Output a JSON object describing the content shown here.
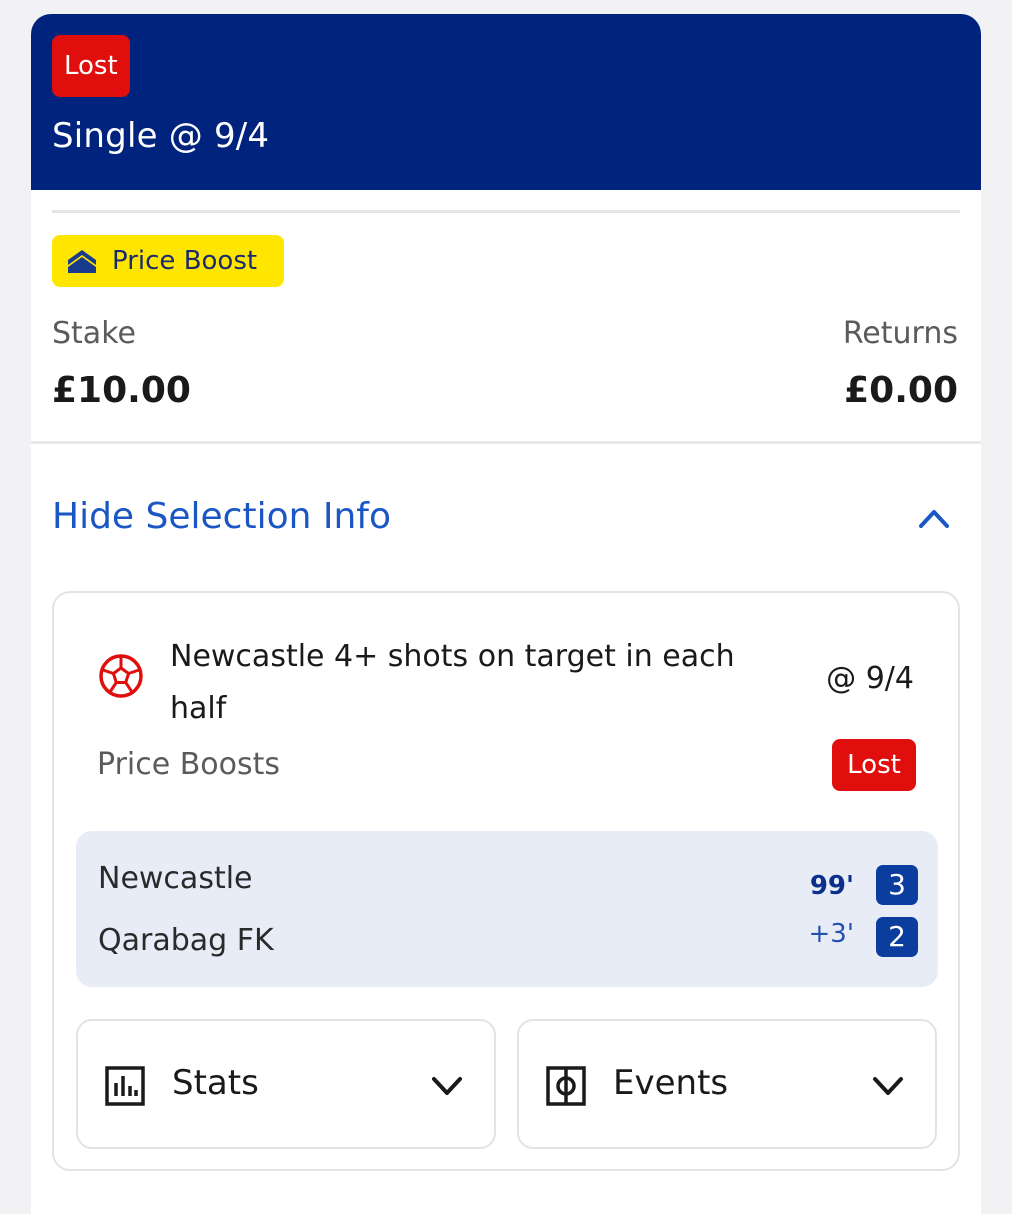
{
  "header": {
    "status": "Lost",
    "title": "Single @ 9/4"
  },
  "boost": {
    "label": "Price Boost",
    "icon": "price-boost-icon"
  },
  "bet": {
    "stake_label": "Stake",
    "stake_value": "£10.00",
    "returns_label": "Returns",
    "returns_value": "£0.00"
  },
  "toggle": {
    "label": "Hide Selection Info",
    "icon": "chevron-up-icon"
  },
  "selection": {
    "title": "Newcastle 4+ shots on target in each half",
    "odds": "@ 9/4",
    "market": "Price Boosts",
    "status": "Lost",
    "sport_icon": "football-icon"
  },
  "scoreboard": {
    "home_team": "Newcastle",
    "away_team": "Qarabag FK",
    "clock": "99'",
    "added_time": "+3'",
    "home_score": "3",
    "away_score": "2"
  },
  "accordions": [
    {
      "label": "Stats",
      "icon": "stats-icon"
    },
    {
      "label": "Events",
      "icon": "pitch-icon"
    }
  ],
  "colors": {
    "header_bg": "#00247d",
    "lost_red": "#e10e0e",
    "boost_yellow": "#ffe600",
    "link_blue": "#1a56c4",
    "score_blue": "#0b3d9e"
  }
}
